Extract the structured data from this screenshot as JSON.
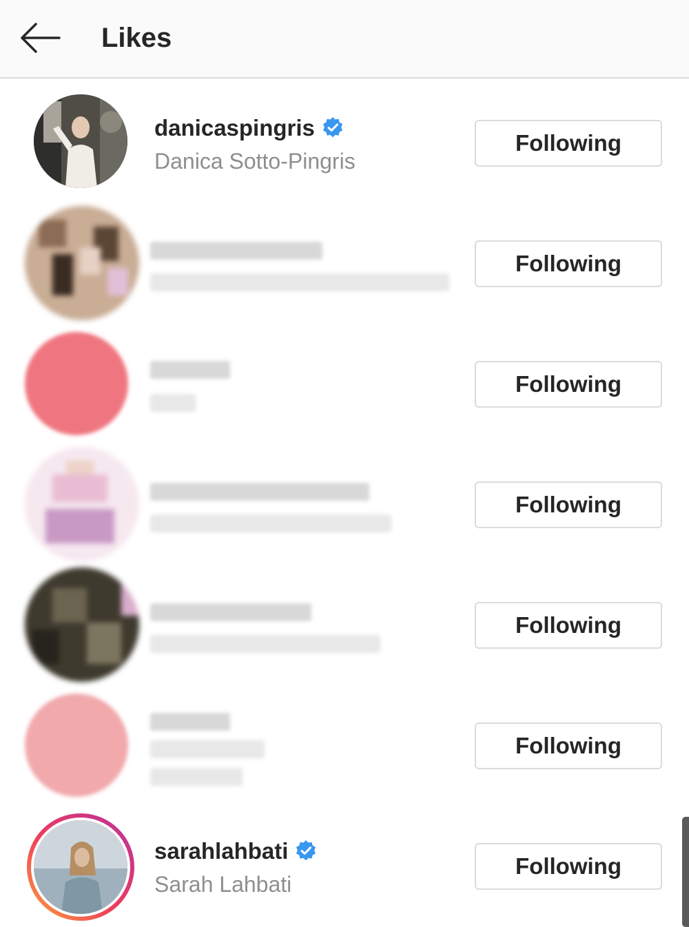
{
  "header": {
    "title": "Likes",
    "back_icon": "arrow-left-icon"
  },
  "users": [
    {
      "username": "danicaspingris",
      "full_name": "Danica Sotto-Pingris",
      "verified": true,
      "button": "Following",
      "avatar_color": "#5a5a52"
    },
    {
      "username": "",
      "full_name": "",
      "verified": false,
      "button": "Following",
      "blurred": true,
      "avatar_color": "#9c7a63"
    },
    {
      "username": "",
      "full_name": "",
      "verified": false,
      "button": "Following",
      "blurred": true,
      "avatar_color": "#ef7680"
    },
    {
      "username": "",
      "full_name": "",
      "verified": false,
      "button": "Following",
      "blurred": true,
      "avatar_color": "#e7c2d6"
    },
    {
      "username": "",
      "full_name": "",
      "verified": false,
      "button": "Following",
      "blurred": true,
      "avatar_color": "#4a4536"
    },
    {
      "username": "",
      "full_name": "",
      "verified": false,
      "button": "Following",
      "blurred": true,
      "avatar_color": "#f1a9ac"
    },
    {
      "username": "sarahlahbati",
      "full_name": "Sarah Lahbati",
      "verified": true,
      "button": "Following",
      "has_story_ring": true,
      "avatar_color": "#a7b6c0"
    }
  ],
  "colors": {
    "verified_badge": "#3897f0",
    "button_border": "#dbdbdb",
    "secondary_text": "#8e8e8e"
  }
}
